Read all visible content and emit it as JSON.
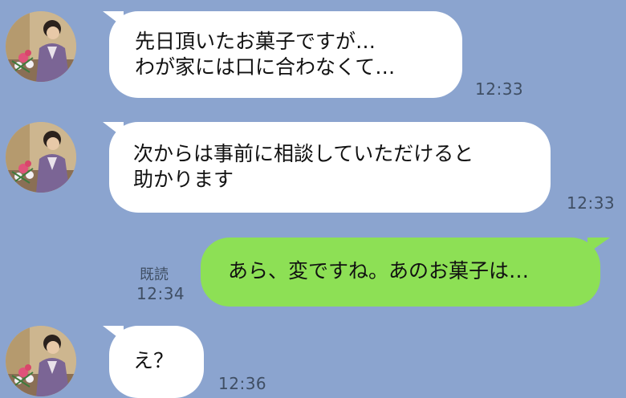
{
  "chat": {
    "messages": [
      {
        "sender": "partner",
        "avatar_icon": "kimono-woman-avatar-icon",
        "text": "先日頂いたお菓子ですが…\nわが家には口に合わなくて…",
        "time": "12:33"
      },
      {
        "sender": "partner",
        "avatar_icon": "kimono-woman-avatar-icon",
        "text": "次からは事前に相談していただけると\n助かります",
        "time": "12:33"
      },
      {
        "sender": "me",
        "text": "あら、変ですね。あのお菓子は…",
        "read_label": "既読",
        "time": "12:34"
      },
      {
        "sender": "partner",
        "avatar_icon": "kimono-woman-avatar-icon",
        "text": "え？",
        "time": "12:36"
      }
    ]
  },
  "colors": {
    "background": "#8ba4cf",
    "incoming_bubble": "#ffffff",
    "outgoing_bubble": "#8de055",
    "timestamp_text": "#3f4e63"
  }
}
